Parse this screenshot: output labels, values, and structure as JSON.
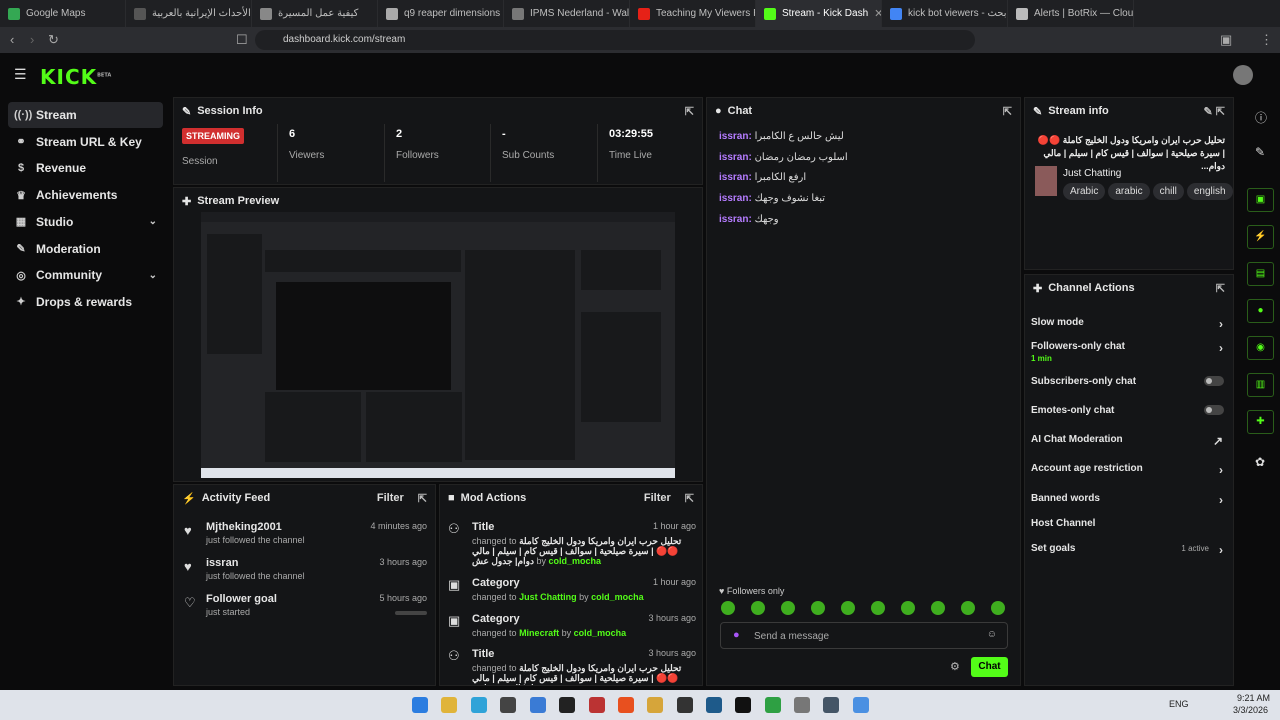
{
  "browser": {
    "tabs": [
      {
        "label": "Google Maps",
        "color": "#34a853"
      },
      {
        "label": "الأحداث الإيرانية بالعربية (@",
        "color": "#555"
      },
      {
        "label": "كيفية عمل المسيرة",
        "color": "#888"
      },
      {
        "label": "q9 reaper dimensions - ...",
        "color": "#aaa"
      },
      {
        "label": "IPMS Nederland - Walk ar...",
        "color": "#777"
      },
      {
        "label": "Teaching My Viewers How",
        "color": "#e62117"
      },
      {
        "label": "Stream - Kick Dash",
        "color": "#53fc18",
        "active": true
      },
      {
        "label": "kick bot viewers - بحث Go",
        "color": "#4285f4"
      },
      {
        "label": "Alerts | BotRix — Cloud St",
        "color": "#bbb"
      }
    ],
    "url": "dashboard.kick.com/stream"
  },
  "brand": {
    "logo": "KICK",
    "beta": "BETA"
  },
  "sidebar": {
    "items": [
      {
        "label": "Stream",
        "icon": "signal-icon",
        "active": true
      },
      {
        "label": "Stream URL & Key",
        "icon": "link-icon"
      },
      {
        "label": "Revenue",
        "icon": "dollar-icon"
      },
      {
        "label": "Achievements",
        "icon": "trophy-icon"
      },
      {
        "label": "Studio",
        "icon": "grid-icon",
        "chevron": true
      },
      {
        "label": "Moderation",
        "icon": "wrench-icon"
      },
      {
        "label": "Community",
        "icon": "globe-icon",
        "chevron": true
      },
      {
        "label": "Drops & rewards",
        "icon": "pin-icon"
      }
    ]
  },
  "session": {
    "title": "Session Info",
    "status": "STREAMING",
    "session_label": "Session",
    "stats": [
      {
        "value": "6",
        "label": "Viewers"
      },
      {
        "value": "2",
        "label": "Followers"
      },
      {
        "value": "-",
        "label": "Sub Counts"
      },
      {
        "value": "03:29:55",
        "label": "Time Live"
      }
    ]
  },
  "preview": {
    "title": "Stream Preview"
  },
  "activity": {
    "title": "Activity Feed",
    "filter": "Filter",
    "items": [
      {
        "name": "Mjtheking2001",
        "sub": "just followed the channel",
        "time": "4 minutes ago",
        "icon": "heart-icon"
      },
      {
        "name": "issran",
        "sub": "just followed the channel",
        "time": "3 hours ago",
        "icon": "heart-icon"
      },
      {
        "name": "Follower goal",
        "sub": "just started",
        "time": "5 hours ago",
        "icon": "heart-outline-icon"
      }
    ]
  },
  "mod": {
    "title": "Mod Actions",
    "filter": "Filter",
    "items": [
      {
        "name": "Title",
        "time": "1 hour ago",
        "pre": "changed to",
        "value": "تحليل حرب ايران وامريكا ودول الخليج كاملة 🔴🔴 | سيرة صيلحية | سوالف | قيس كام | سيلم | مالي دوام| جدول عش",
        "by": "by",
        "user": "cold_mocha",
        "icon": "person-icon"
      },
      {
        "name": "Category",
        "time": "1 hour ago",
        "pre": "changed to",
        "value": "Just Chatting",
        "by": "by",
        "user": "cold_mocha",
        "icon": "category-icon"
      },
      {
        "name": "Category",
        "time": "3 hours ago",
        "pre": "changed to",
        "value": "Minecraft",
        "by": "by",
        "user": "cold_mocha",
        "icon": "category-icon"
      },
      {
        "name": "Title",
        "time": "3 hours ago",
        "pre": "changed to",
        "value": "تحليل حرب ايران وامريكا ودول الخليج كاملة 🔴🔴 | سيرة صيلحية | سوالف | قيس كام | سيلم | مالي دوام| الشعب مابين",
        "by": "",
        "user": "",
        "icon": "person-icon"
      }
    ]
  },
  "chat": {
    "title": "Chat",
    "messages": [
      {
        "user": "issran:",
        "text": "ليش حالس ع الكامبرا"
      },
      {
        "user": "issran:",
        "text": "اسلوب رمضان رمضان"
      },
      {
        "user": "issran:",
        "text": "ارفع الكامبرا"
      },
      {
        "user": "issran:",
        "text": "تبغا نشوف وجهك"
      },
      {
        "user": "issran:",
        "text": "وجهك"
      }
    ],
    "mode": "Followers only",
    "placeholder": "Send a message",
    "send": "Chat"
  },
  "streaminfo": {
    "title": "Stream info",
    "stream_title": "تحليل حرب ايران وامريكا ودول الخليج كاملة 🔴🔴 | سيرة صيلحية | سوالف | قيس كام | سيلم | مالي دوام...",
    "category": "Just Chatting",
    "tags": [
      "Arabic",
      "arabic",
      "chill",
      "english"
    ]
  },
  "channel": {
    "title": "Channel Actions",
    "actions": [
      {
        "label": "Slow mode",
        "type": "chevron"
      },
      {
        "label": "Followers-only chat",
        "sub": "1 min",
        "type": "chevron"
      },
      {
        "label": "Subscribers-only chat",
        "type": "toggle"
      },
      {
        "label": "Emotes-only chat",
        "type": "toggle"
      },
      {
        "label": "AI Chat Moderation",
        "type": "external"
      },
      {
        "label": "Account age restriction",
        "type": "chevron"
      },
      {
        "label": "Banned words",
        "type": "chevron"
      },
      {
        "label": "Host Channel",
        "type": "none"
      },
      {
        "label": "Set goals",
        "status": "1 active",
        "type": "chevron"
      }
    ]
  },
  "taskbar": {
    "lang": "ENG",
    "time": "9:21 AM",
    "date": "3/3/2026"
  }
}
